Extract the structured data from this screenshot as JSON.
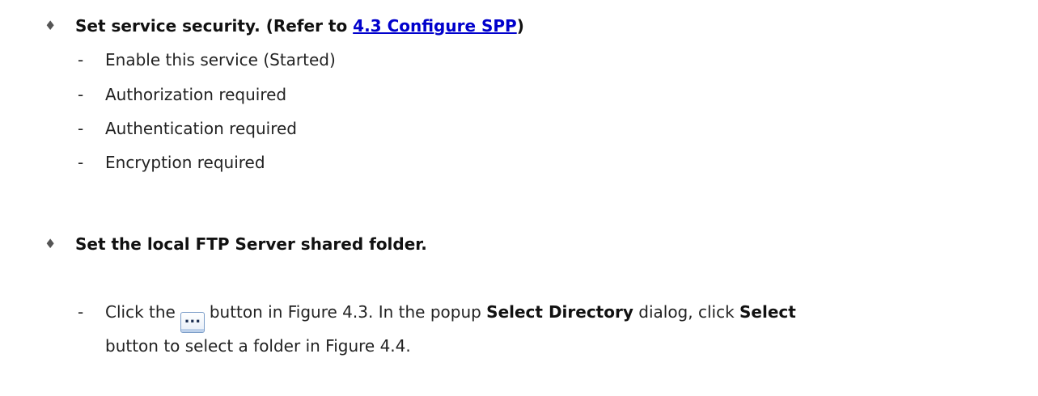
{
  "section1": {
    "heading_prefix": "Set service security. (Refer to ",
    "heading_link": "4.3 Configure SPP",
    "heading_suffix": ")",
    "items": [
      "Enable this service (Started)",
      "Authorization required",
      "Authentication required",
      "Encryption required"
    ]
  },
  "section2": {
    "heading": "Set the local FTP Server shared folder.",
    "item": {
      "part1": "Click the",
      "button_label": "...",
      "part2": "button in Figure 4.3. In the popup",
      "bold1": "Select Directory",
      "part3": "dialog, click",
      "bold2": "Select",
      "line2": "button to select a folder in Figure 4.4."
    }
  },
  "bullet_symbol": "♦",
  "dash_symbol": "-",
  "colors": {
    "link": "#0000cc",
    "text": "#222222"
  }
}
